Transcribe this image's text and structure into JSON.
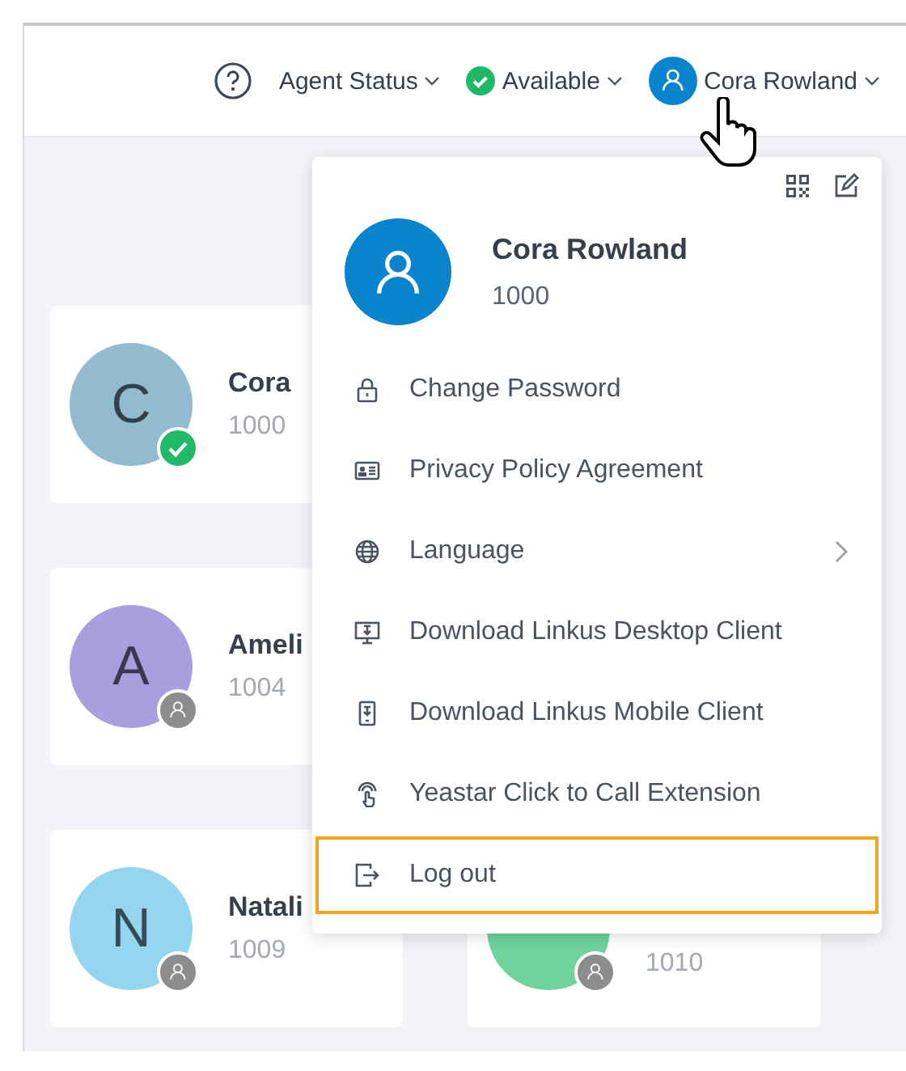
{
  "header": {
    "agent_status": "Agent Status",
    "status": {
      "label": "Available",
      "selected": true
    },
    "user": "Cora Rowland"
  },
  "contacts": [
    {
      "initial": "C",
      "name": "Cora",
      "extension": "1000",
      "color": "#93bbd0",
      "online": true
    },
    {
      "initial": "A",
      "name": "Ameli",
      "extension": "1004",
      "color": "#a99fde",
      "online": false
    },
    {
      "initial": "N",
      "name": "Natali",
      "extension": "1009",
      "color": "#94d6f0",
      "online": false
    },
    {
      "extension": "1010",
      "color": "#6fd39b",
      "online": false
    }
  ],
  "menu": {
    "name": "Cora Rowland",
    "extension": "1000",
    "items": [
      {
        "label": "Change Password",
        "submenu": false,
        "highlighted": false
      },
      {
        "label": "Privacy Policy Agreement",
        "submenu": false,
        "highlighted": false
      },
      {
        "label": "Language",
        "submenu": true,
        "highlighted": false
      },
      {
        "label": "Download Linkus Desktop Client",
        "submenu": false,
        "highlighted": false
      },
      {
        "label": "Download Linkus Mobile Client",
        "submenu": false,
        "highlighted": false
      },
      {
        "label": "Yeastar Click to Call Extension",
        "submenu": false,
        "highlighted": false
      },
      {
        "label": "Log out",
        "submenu": false,
        "highlighted": true
      }
    ]
  }
}
